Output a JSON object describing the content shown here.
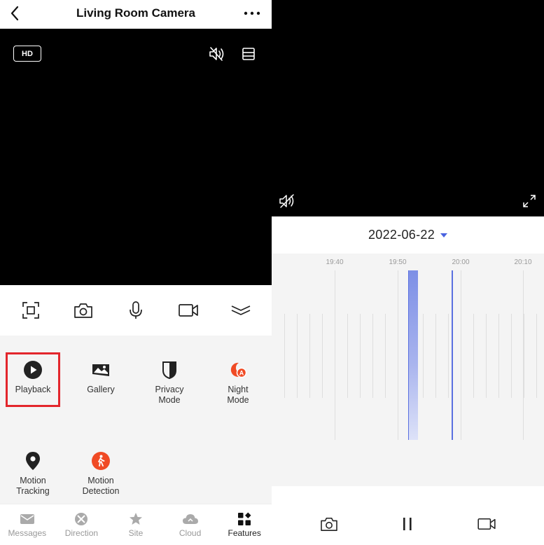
{
  "header": {
    "title": "Living Room Camera"
  },
  "video": {
    "hd_label": "HD"
  },
  "features": [
    {
      "label": "Playback",
      "icon": "play-circle-icon"
    },
    {
      "label": "Gallery",
      "icon": "image-icon"
    },
    {
      "label": "Privacy\nMode",
      "icon": "shield-icon"
    },
    {
      "label": "Night\nMode",
      "icon": "night-mode-icon"
    },
    {
      "label": "Motion\nTracking",
      "icon": "location-pin-icon"
    },
    {
      "label": "Motion\nDetection",
      "icon": "walking-person-icon"
    }
  ],
  "tabs": [
    {
      "label": "Messages",
      "icon": "envelope-icon"
    },
    {
      "label": "Direction",
      "icon": "direction-icon"
    },
    {
      "label": "Site",
      "icon": "star-icon"
    },
    {
      "label": "Cloud",
      "icon": "cloud-icon"
    },
    {
      "label": "Features",
      "icon": "grid-icon",
      "active": true
    }
  ],
  "playback": {
    "date": "2022-06-22",
    "ticks": [
      "19:40",
      "19:50",
      "20:00",
      "20:10"
    ]
  },
  "colors": {
    "accent": "#5a70e0",
    "highlight": "#e3262c",
    "night_mode": "#f04a24",
    "motion_detection": "#f04a24"
  }
}
